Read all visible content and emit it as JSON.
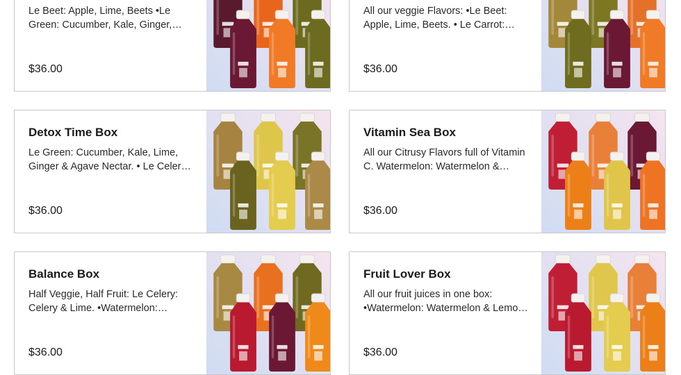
{
  "products": [
    {
      "name": "",
      "description": "Le Beet: Apple, Lime, Beets •Le Green: Cucumber, Kale, Ginger, Lime & Agave Nectar.",
      "price": "$36.00",
      "bottles": [
        {
          "label": "le beet",
          "color": "#5a1a2e"
        },
        {
          "label": "le carrot",
          "color": "#e8661c"
        },
        {
          "label": "le green",
          "color": "#6b6a1e"
        },
        {
          "label": "le beet",
          "color": "#6a1833"
        },
        {
          "label": "le carrot",
          "color": "#f07a25"
        },
        {
          "label": "le green",
          "color": "#6d6b20"
        }
      ]
    },
    {
      "name": "",
      "description": "All our veggie Flavors: •Le Beet: Apple, Lime, Beets. • Le Carrot: Carrot, Apple & Ginger.",
      "price": "$36.00",
      "bottles": [
        {
          "label": "le celery",
          "color": "#a3873a"
        },
        {
          "label": "le green",
          "color": "#7d7622"
        },
        {
          "label": "le carrot",
          "color": "#e4712a"
        },
        {
          "label": "le green",
          "color": "#6f6b1f"
        },
        {
          "label": "le beet",
          "color": "#6a1833"
        },
        {
          "label": "le carrot",
          "color": "#f07a25"
        }
      ]
    },
    {
      "name": "Detox Time Box",
      "description": "Le Green: Cucumber, Kale, Lime, Ginger & Agave Nectar. • Le Celery: Celery & Lime.",
      "price": "$36.00",
      "bottles": [
        {
          "label": "le celery",
          "color": "#a68340"
        },
        {
          "label": "pineapple",
          "color": "#ddc64a"
        },
        {
          "label": "le green",
          "color": "#7a7428"
        },
        {
          "label": "le green",
          "color": "#6a6320"
        },
        {
          "label": "pineapple",
          "color": "#e3cc4e"
        },
        {
          "label": "le celery",
          "color": "#ab8a48"
        }
      ]
    },
    {
      "name": "Vitamin Sea Box",
      "description": "All our Citrusy Flavors full of Vitamin C. Watermelon: Watermelon & Lemon. •Tangerine.",
      "price": "$36.00",
      "bottles": [
        {
          "label": "watermelon",
          "color": "#c01e34"
        },
        {
          "label": "grapefruit",
          "color": "#e9803a"
        },
        {
          "label": "le beet",
          "color": "#6a1833"
        },
        {
          "label": "tangerine",
          "color": "#ec7f18"
        },
        {
          "label": "pineapple",
          "color": "#e0c54a"
        },
        {
          "label": "le carrot",
          "color": "#ee7424"
        }
      ]
    },
    {
      "name": "Balance Box",
      "description": "Half Veggie, Half Fruit: Le Celery: Celery & Lime. •Watermelon: Watermelon & Lemon.",
      "price": "$36.00",
      "bottles": [
        {
          "label": "le celery",
          "color": "#a78944"
        },
        {
          "label": "le carrot",
          "color": "#e8711f"
        },
        {
          "label": "le green",
          "color": "#6f6a20"
        },
        {
          "label": "watermelon",
          "color": "#b91a30"
        },
        {
          "label": "le beet",
          "color": "#6a1833"
        },
        {
          "label": "tangerine",
          "color": "#ef8a1a"
        }
      ]
    },
    {
      "name": "Fruit Lover Box",
      "description": "All our fruit juices in one box: •Watermelon: Watermelon & Lemon. •Pineapple.",
      "price": "$36.00",
      "bottles": [
        {
          "label": "watermelon",
          "color": "#c01e34"
        },
        {
          "label": "pineapple",
          "color": "#dfc64c"
        },
        {
          "label": "grapefruit",
          "color": "#e9803a"
        },
        {
          "label": "watermelon",
          "color": "#b91a30"
        },
        {
          "label": "pineapple",
          "color": "#e3cc4e"
        },
        {
          "label": "tangerine",
          "color": "#ec7f18"
        }
      ]
    }
  ]
}
